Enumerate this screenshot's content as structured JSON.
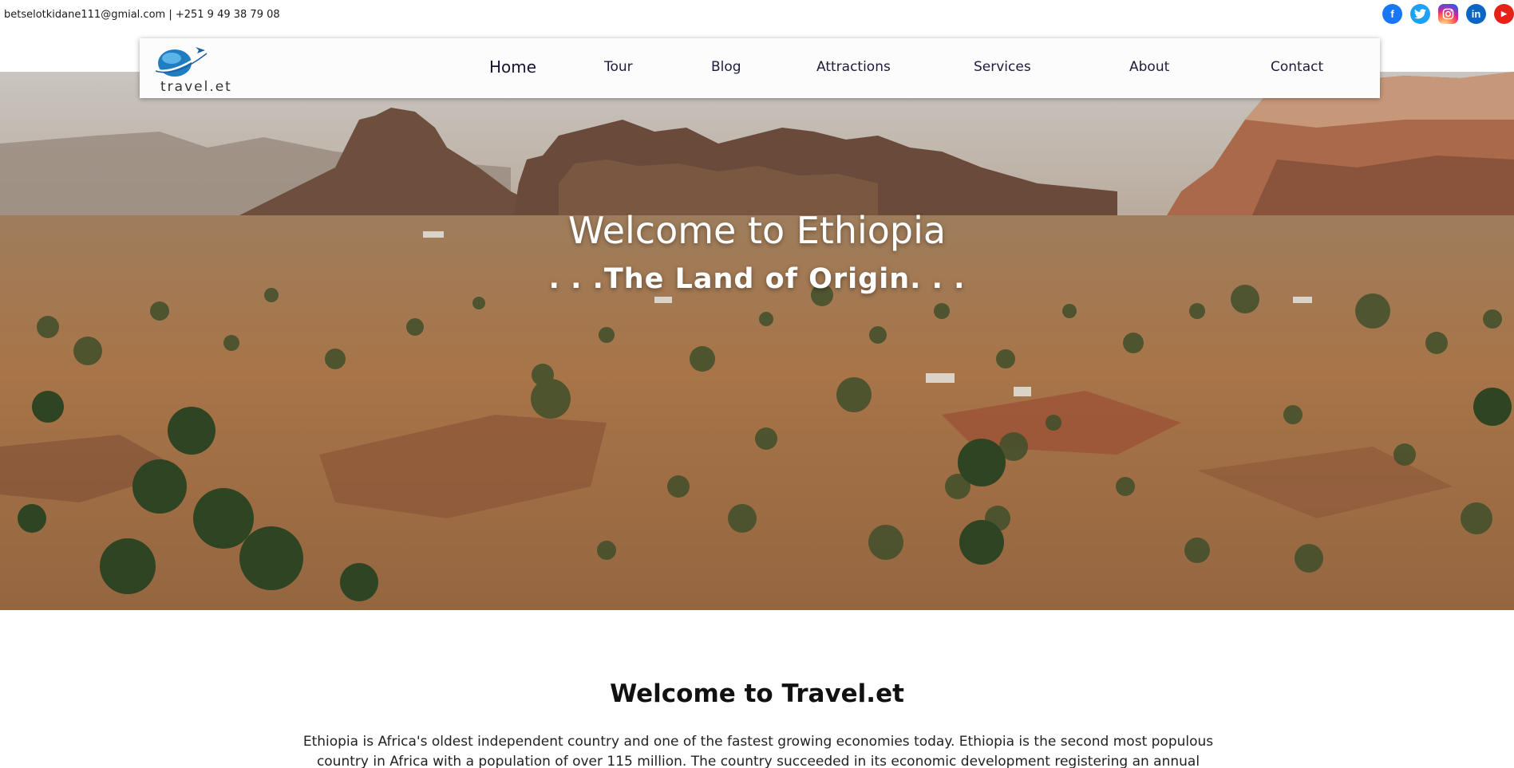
{
  "topbar": {
    "contact": "betselotkidane111@gmial.com | +251 9 49 38 79 08",
    "social": [
      {
        "name": "facebook-icon",
        "glyph": "f"
      },
      {
        "name": "twitter-icon",
        "glyph": "t"
      },
      {
        "name": "instagram-icon",
        "glyph": "◎"
      },
      {
        "name": "linkedin-icon",
        "glyph": "in"
      },
      {
        "name": "youtube-icon",
        "glyph": "▶"
      }
    ]
  },
  "brand": {
    "logo_text": "travel.et",
    "logo_icon": "globe-plane-icon"
  },
  "nav": {
    "home": "Home",
    "tour": "Tour",
    "blog": "Blog",
    "attractions": "Attractions",
    "services": "Services",
    "about": "About",
    "contact": "Contact"
  },
  "hero": {
    "title": "Welcome to Ethiopia",
    "subtitle": ". . .The Land of Origin. . ."
  },
  "intro": {
    "title": "Welcome to Travel.et",
    "text": "Ethiopia is Africa's oldest independent country and one of the fastest growing economies today. Ethiopia is the second most populous country in Africa with a population of over 115 million. The country succeeded in its economic development registering an annual economic growth rate"
  },
  "colors": {
    "nav_text": "#1c1c3c",
    "accent": "#1877f2"
  }
}
